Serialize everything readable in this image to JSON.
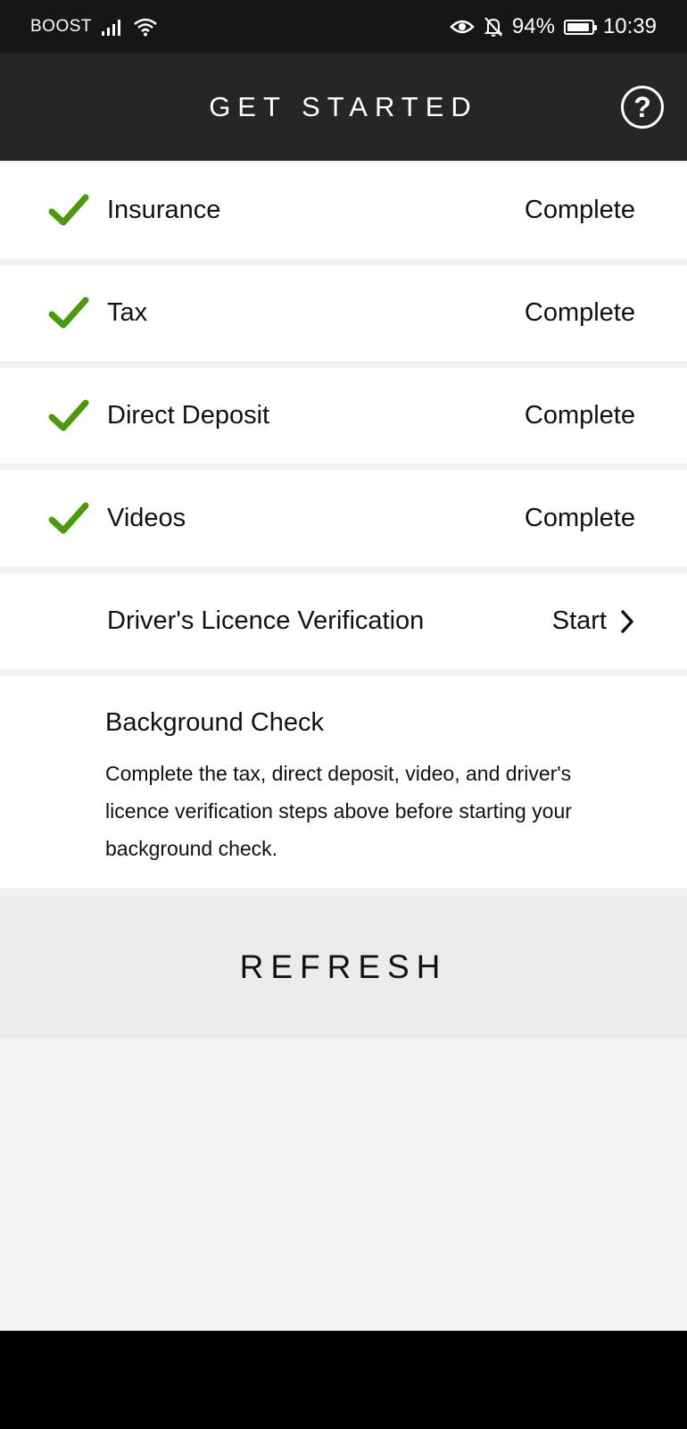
{
  "status_bar": {
    "carrier": "BOOST",
    "battery": "94%",
    "battery_level": 0.94,
    "time": "10:39",
    "icons": [
      "signal-icon",
      "wifi-icon",
      "eye-icon",
      "bell-off-icon",
      "battery-icon"
    ]
  },
  "header": {
    "title": "GET STARTED",
    "help_icon": "help-circle-icon",
    "help_glyph": "?"
  },
  "steps": [
    {
      "label": "Insurance",
      "status": "Complete",
      "done": true
    },
    {
      "label": "Tax",
      "status": "Complete",
      "done": true
    },
    {
      "label": "Direct Deposit",
      "status": "Complete",
      "done": true
    },
    {
      "label": "Videos",
      "status": "Complete",
      "done": true
    },
    {
      "label": "Driver's Licence Verification",
      "status": "Start",
      "done": false
    }
  ],
  "background_check": {
    "title": "Background Check",
    "description": "Complete the tax, direct deposit, video, and driver's licence verification steps above before starting your background check."
  },
  "refresh": {
    "label": "REFRESH"
  },
  "colors": {
    "check": "#4a9a0b",
    "header_bg": "#262626",
    "status_bg": "#161616"
  }
}
